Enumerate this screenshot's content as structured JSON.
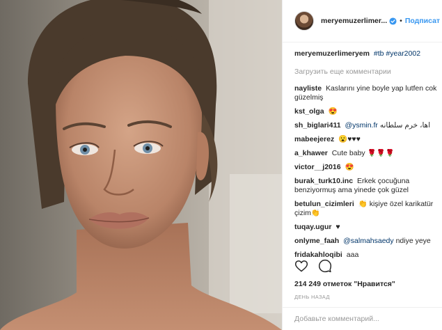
{
  "header": {
    "username": "meryemuzerlimer...",
    "separator": "•",
    "follow_label": "Подписат"
  },
  "caption": {
    "username": "meryemuzerlimeryem",
    "hashtags": "#tb #year2002"
  },
  "load_more_label": "Загрузить еще комментарии",
  "comments": [
    {
      "username": "nayliste",
      "text": "Kaslarını yine boyle yap lutfen cok güzelmiş"
    },
    {
      "username": "kst_olga",
      "text": "😍"
    },
    {
      "username": "sh_biglari411",
      "mention": "@ysmin.fr",
      "text": "اها، خرم سلطانه"
    },
    {
      "username": "mabeejerez",
      "text": "😮♥♥♥"
    },
    {
      "username": "a_khawer",
      "text": "Cute baby 🌹🌹🌹"
    },
    {
      "username": "victor__j2016",
      "text": "😍"
    },
    {
      "username": "burak_turk10.inc",
      "text": "Erkek çocuğuna benziyormuş ama yinede çok güzel"
    },
    {
      "username": "betulun_cizimleri",
      "text": "👏 kişiye özel karikatür çizim👏"
    },
    {
      "username": "tuqay.ugur",
      "text": "♥"
    },
    {
      "username": "onlyme_faah",
      "mention": "@salmahsaedy",
      "text": "ndiye yeye"
    },
    {
      "username": "fridakahloqibi",
      "text": "aaa"
    }
  ],
  "likes_text": "214 249 отметок \"Нравится\"",
  "time_text": "ДЕНЬ НАЗАД",
  "add_comment_placeholder": "Добавьте комментарий...",
  "icons": {
    "verified": "verified-badge-icon",
    "like": "heart-outline-icon",
    "comment": "speech-bubble-icon"
  },
  "colors": {
    "link": "#3897f0",
    "hashtag": "#003569",
    "muted": "#999999",
    "text": "#262626"
  }
}
